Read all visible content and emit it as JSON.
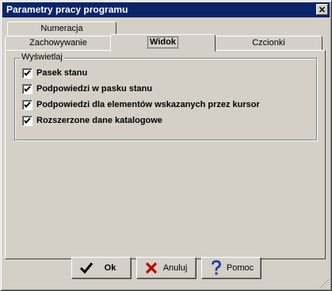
{
  "window": {
    "title": "Parametry pracy programu",
    "close_glyph": "✕"
  },
  "tabs": {
    "back_row": [
      "Numeracja"
    ],
    "front_row": [
      "Zachowywanie",
      "Widok",
      "Czcionki"
    ],
    "active": "Widok"
  },
  "group": {
    "title": "Wyświetlaj",
    "items": [
      {
        "label": "Pasek stanu",
        "checked": true
      },
      {
        "label": "Podpowiedzi w pasku stanu",
        "checked": true
      },
      {
        "label": "Podpowiedzi dla elementów wskazanych przez kursor",
        "checked": true
      },
      {
        "label": "Rozszerzone dane katalogowe",
        "checked": true
      }
    ]
  },
  "buttons": {
    "ok": {
      "label": "Ok",
      "icon": "check-icon"
    },
    "cancel": {
      "label": "Anuluj",
      "icon": "cross-icon"
    },
    "help": {
      "label": "Pomoc",
      "icon": "question-icon"
    }
  },
  "colors": {
    "titlebar": "#0a246a",
    "face": "#d4d0c8",
    "cross": "#c00000",
    "question": "#1f3fa0"
  }
}
